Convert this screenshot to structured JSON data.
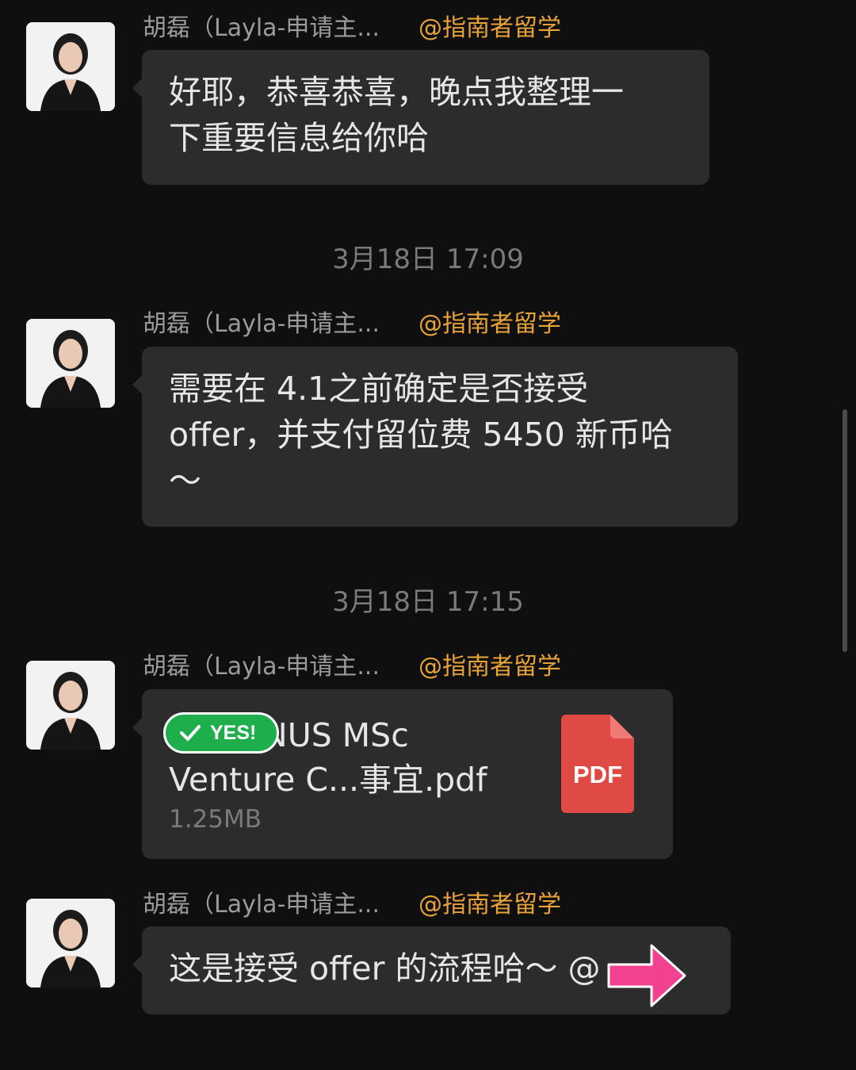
{
  "colors": {
    "background": "#0f0f0f",
    "bubble": "#2c2c2c",
    "sender_name": "#9b9b9b",
    "org_tag": "#e8a23a",
    "timestamp": "#7a7a7a",
    "pdf_red": "#e04a45",
    "badge_green": "#1fae4c",
    "arrow_pink": "#f2418f"
  },
  "messages": [
    {
      "sender": "胡磊（Layla-申请主...",
      "org": "@指南者留学",
      "text": "好耶，恭喜恭喜，晚点我整理一\n下重要信息给你哈"
    },
    {
      "timestamp": "3月18日 17:09"
    },
    {
      "sender": "胡磊（Layla-申请主...",
      "org": "@指南者留学",
      "text": "需要在 4.1之前确定是否接受\noffer，并支付留位费 5450 新币哈\n～"
    },
    {
      "timestamp": "3月18日 17:15"
    },
    {
      "sender": "胡磊（Layla-申请主...",
      "org": "@指南者留学",
      "file": {
        "name": "        -NUS MSc\nVenture C...事宜.pdf",
        "size": "1.25MB",
        "icon": "pdf-file-icon",
        "icon_label": "PDF"
      }
    },
    {
      "sender": "胡磊（Layla-申请主...",
      "org": "@指南者留学",
      "text": "这是接受 offer 的流程哈～ @     n"
    }
  ],
  "overlays": {
    "badge_text": "YES!",
    "badge_icon": "checkmark-icon",
    "arrow_icon": "pink-arrow-icon"
  }
}
